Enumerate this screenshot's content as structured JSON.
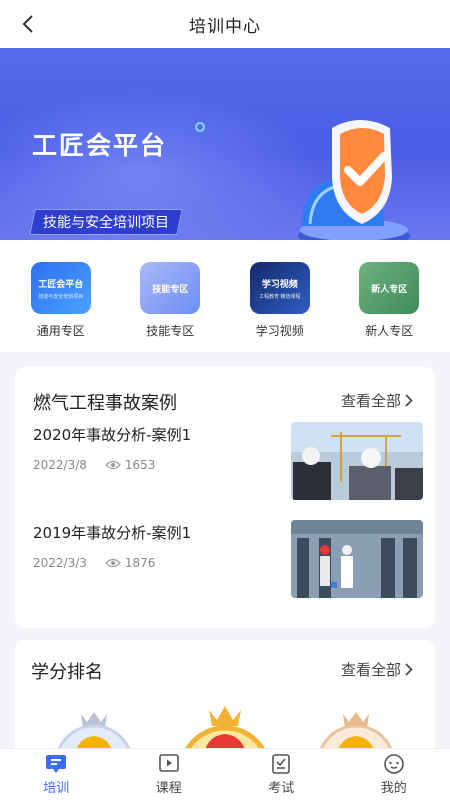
{
  "header": {
    "title": "培训中心"
  },
  "banner": {
    "title": "工匠会平台",
    "subtitle": "技能与安全培训项目",
    "active_slide": 2,
    "slide_count": 3
  },
  "quick_entries": [
    {
      "label": "通用专区",
      "icon_title": "工匠会平台",
      "icon_sub": "技能与安全培训项目",
      "color": "#3a7bf0"
    },
    {
      "label": "技能专区",
      "icon_title": "技能专区",
      "icon_sub": "",
      "color": "#8aa6f7"
    },
    {
      "label": "学习视频",
      "icon_title": "学习视频",
      "icon_sub": "工程教育  精选课程",
      "color": "#1f3e8f"
    },
    {
      "label": "新人专区",
      "icon_title": "新人专区",
      "icon_sub": "",
      "color": "#4e9a63"
    }
  ],
  "cases": {
    "title": "燃气工程事故案例",
    "more": "查看全部",
    "items": [
      {
        "title": "2020年事故分析-案例1",
        "date": "2022/3/8",
        "views": "1653"
      },
      {
        "title": "2019年事故分析-案例1",
        "date": "2022/3/3",
        "views": "1876"
      }
    ]
  },
  "ranking": {
    "title": "学分排名",
    "more": "查看全部"
  },
  "tabbar": {
    "items": [
      {
        "label": "培训",
        "active": true
      },
      {
        "label": "课程",
        "active": false
      },
      {
        "label": "考试",
        "active": false
      },
      {
        "label": "我的",
        "active": false
      }
    ]
  },
  "colors": {
    "accent": "#3d6df3",
    "banner": "#4b5de4"
  }
}
